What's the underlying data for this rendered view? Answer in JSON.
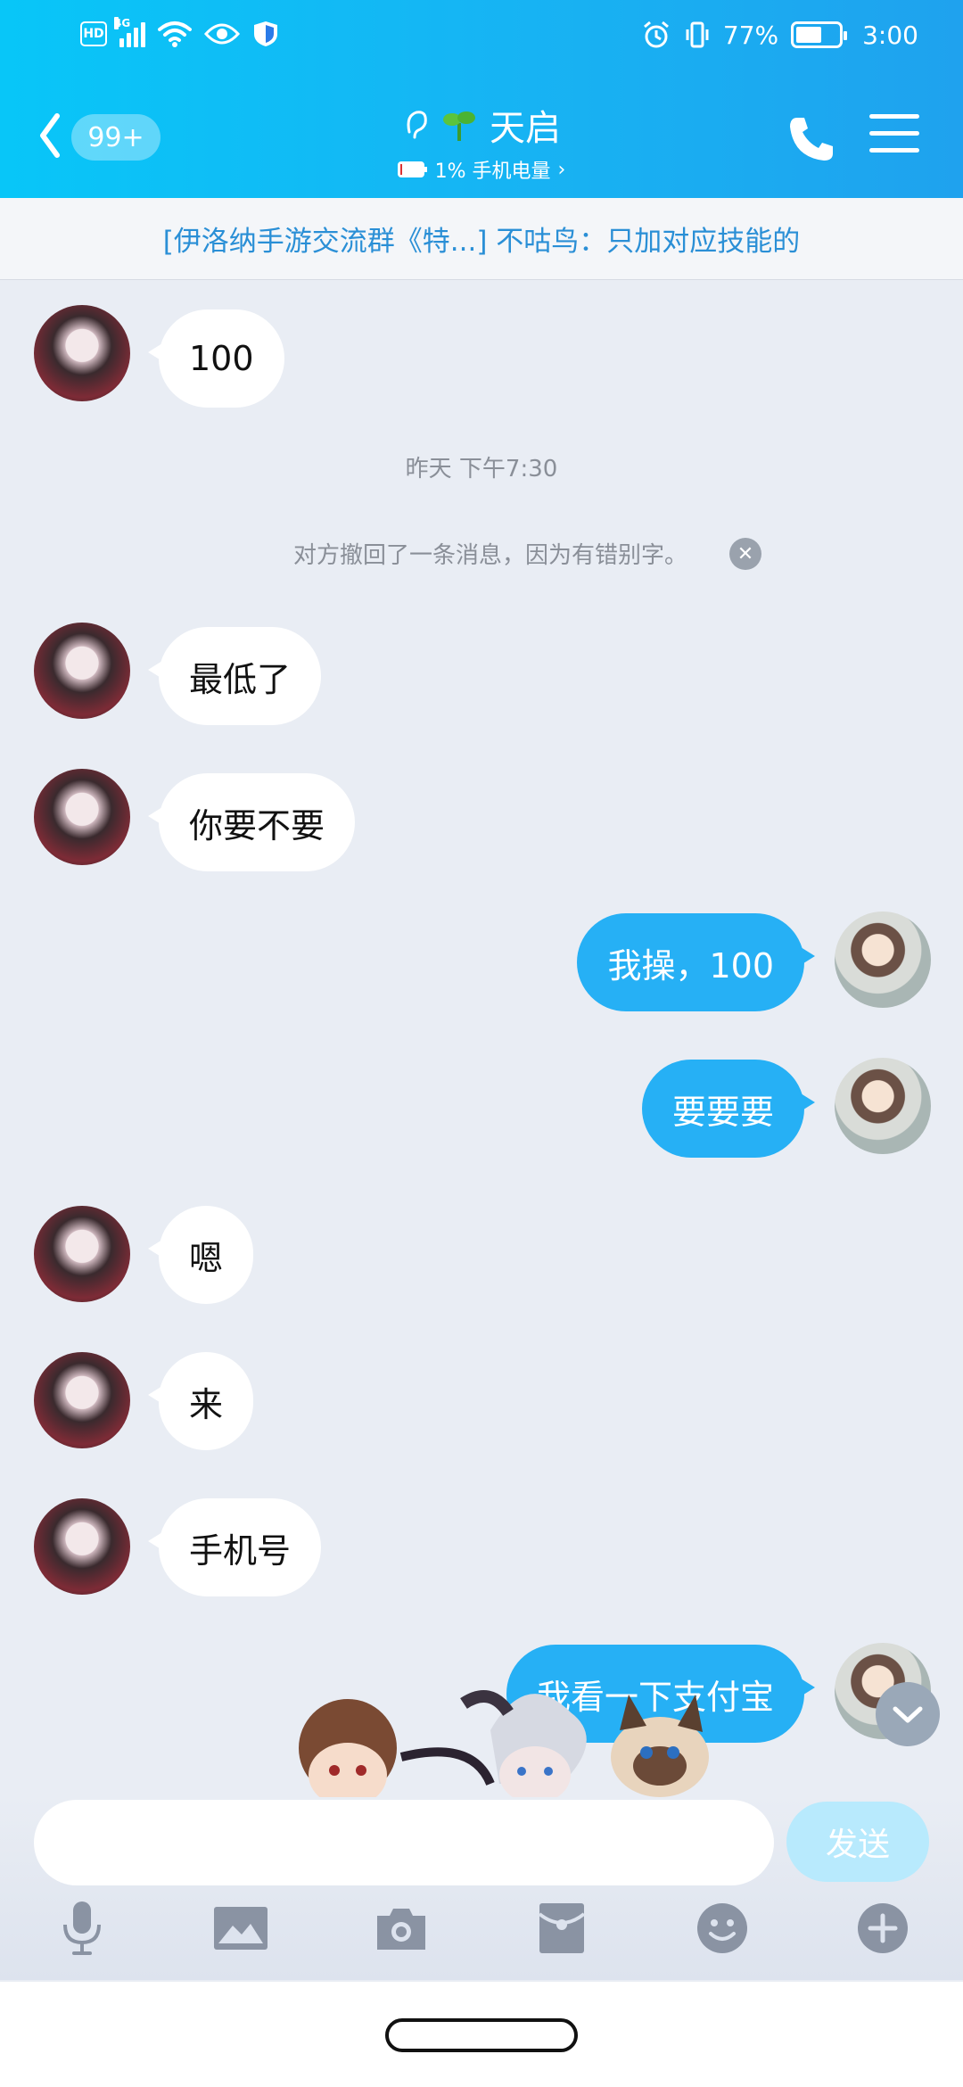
{
  "status_bar": {
    "network": "4G",
    "battery_percent": "77%",
    "time": "3:00"
  },
  "header": {
    "badge": "99+",
    "title": "天启",
    "subtitle": "1% 手机电量",
    "subtitle_chevron": "›"
  },
  "banner": {
    "text": "[伊洛纳手游交流群《特...] 不咕鸟：只加对应技能的"
  },
  "messages": [
    {
      "side": "in",
      "text": "100"
    },
    {
      "side": "in",
      "text": "最低了"
    },
    {
      "side": "in",
      "text": "你要不要"
    },
    {
      "side": "out",
      "text": "我操，100"
    },
    {
      "side": "out",
      "text": "要要要"
    },
    {
      "side": "in",
      "text": "嗯"
    },
    {
      "side": "in",
      "text": "来"
    },
    {
      "side": "in",
      "text": "手机号"
    },
    {
      "side": "out",
      "text": "我看一下支付宝"
    }
  ],
  "timestamp": "昨天 下午7:30",
  "recall_notice": "对方撤回了一条消息，因为有错别字。",
  "composer": {
    "placeholder": "",
    "send_label": "发送"
  },
  "toolbar_icons": [
    "microphone-icon",
    "image-icon",
    "camera-icon",
    "red-packet-icon",
    "emoji-icon",
    "plus-icon"
  ],
  "colors": {
    "header_start": "#08c6f8",
    "header_end": "#1fa2ee",
    "out_bubble": "#26b0f5",
    "background": "#e9edf4"
  }
}
